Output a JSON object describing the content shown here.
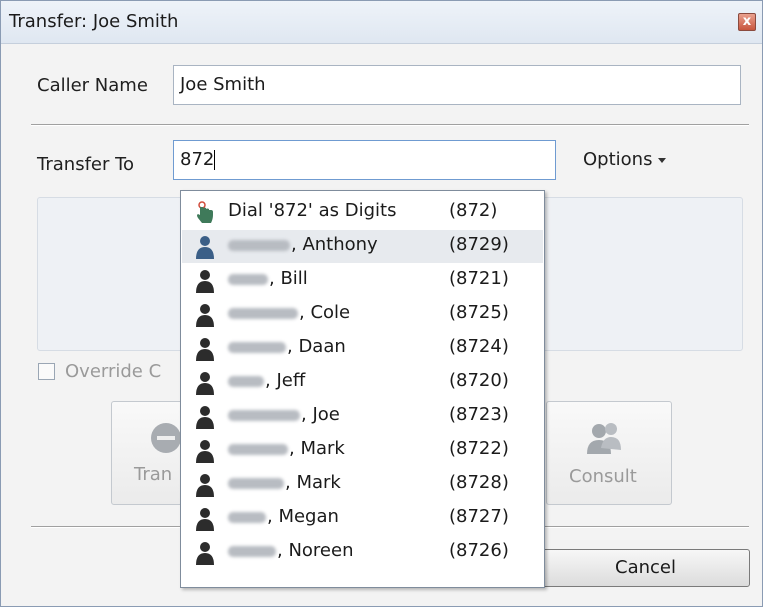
{
  "window": {
    "title": "Transfer: Joe Smith",
    "close_glyph": "x"
  },
  "caller": {
    "label": "Caller Name",
    "value": "Joe Smith"
  },
  "transfer": {
    "label": "Transfer To",
    "value": "872"
  },
  "options": {
    "label": "Options"
  },
  "override": {
    "label": "Override C"
  },
  "buttons": {
    "transfer_label": "Tran",
    "consult_label": "Consult",
    "cancel_label": "Cancel"
  },
  "dropdown": {
    "items": [
      {
        "name": "Dial '872' as Digits",
        "ext": "(872)",
        "icon": "dial-hand-icon"
      },
      {
        "name": ", Anthony",
        "ext": "(8729)",
        "icon": "contact-person-icon",
        "highlighted": true
      },
      {
        "name": ", Bill",
        "ext": "(8721)",
        "icon": "contact-person-icon"
      },
      {
        "name": ", Cole",
        "ext": "(8725)",
        "icon": "contact-person-icon"
      },
      {
        "name": ", Daan",
        "ext": "(8724)",
        "icon": "contact-person-icon"
      },
      {
        "name": ", Jeff",
        "ext": "(8720)",
        "icon": "contact-person-icon"
      },
      {
        "name": ", Joe",
        "ext": "(8723)",
        "icon": "contact-person-icon"
      },
      {
        "name": ", Mark",
        "ext": "(8722)",
        "icon": "contact-person-icon"
      },
      {
        "name": ", Mark",
        "ext": "(8728)",
        "icon": "contact-person-icon"
      },
      {
        "name": ", Megan",
        "ext": "(8727)",
        "icon": "contact-person-icon"
      },
      {
        "name": ", Noreen",
        "ext": "(8726)",
        "icon": "contact-person-icon"
      }
    ]
  },
  "colors": {
    "highlight": "#e7eaee",
    "titlebar": "#e4ebf4"
  }
}
